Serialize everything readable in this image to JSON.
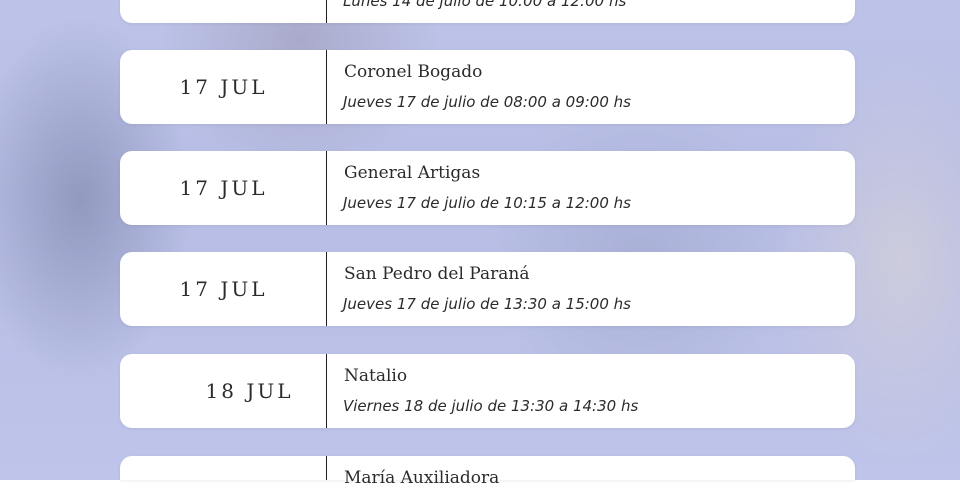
{
  "schedule": [
    {
      "date": "",
      "place": "",
      "time": "Lunes 14 de julio de 10:00 a 12:00 hs"
    },
    {
      "date": "17 JUL",
      "place": "Coronel Bogado",
      "time": "Jueves 17 de julio de 08:00 a 09:00 hs"
    },
    {
      "date": "17 JUL",
      "place": "General Artigas",
      "time": "Jueves 17 de julio de 10:15 a 12:00 hs"
    },
    {
      "date": "17 JUL",
      "place": "San Pedro del Paraná",
      "time": "Jueves 17 de julio de 13:30 a 15:00 hs"
    },
    {
      "date": "18 JUL",
      "place": "Natalio",
      "time": "Viernes 18 de julio de 13:30 a 14:30 hs"
    },
    {
      "date": "",
      "place": "María Auxiliadora",
      "time": ""
    }
  ]
}
